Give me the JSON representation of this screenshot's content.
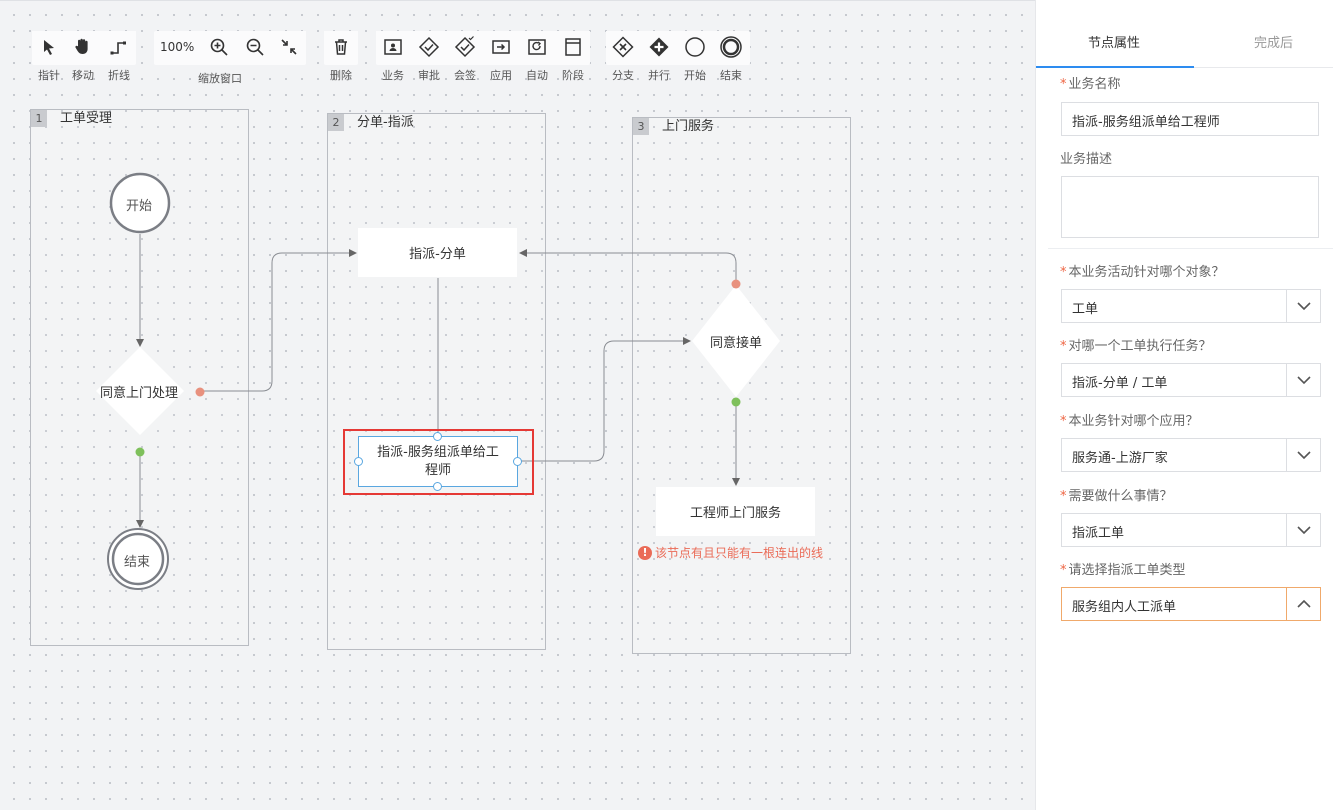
{
  "toolbar": {
    "pointer_label": "指针",
    "move_label": "移动",
    "polyline_label": "折线",
    "zoom_value": "100%",
    "zoom_window_label": "缩放窗口",
    "delete_label": "删除",
    "business_label": "业务",
    "approve_label": "审批",
    "countersign_label": "会签",
    "application_label": "应用",
    "auto_label": "自动",
    "stage_label": "阶段",
    "branch_label": "分支",
    "parallel_label": "并行",
    "start_label": "开始",
    "end_label": "结束"
  },
  "lanes": [
    {
      "num": "1",
      "title": "工单受理"
    },
    {
      "num": "2",
      "title": "分单-指派"
    },
    {
      "num": "3",
      "title": "上门服务"
    }
  ],
  "nodes": {
    "start": "开始",
    "end": "结束",
    "decision_visit": "同意上门处理",
    "assign_split": "指派-分单",
    "assign_engineer": "指派-服务组派单给工程师",
    "decision_accept": "同意接单",
    "engineer_visit": "工程师上门服务",
    "error_message": "该节点有且只能有一根连出的线"
  },
  "panel": {
    "tabs": [
      "节点属性",
      "完成后"
    ],
    "business_name_label": "业务名称",
    "business_name_value": "指派-服务组派单给工程师",
    "business_desc_label": "业务描述",
    "business_desc_value": "",
    "q_object_label": "本业务活动针对哪个对象？",
    "q_object_value": "工单",
    "q_ticket_label": "对哪一个工单执行任务？",
    "q_ticket_value": "指派-分单 / 工单",
    "q_app_label": "本业务针对哪个应用？",
    "q_app_value": "服务通-上游厂家",
    "q_todo_label": "需要做什么事情？",
    "q_todo_value": "指派工单",
    "q_type_label": "请选择指派工单类型",
    "q_type_value": "服务组内人工派单"
  },
  "colors": {
    "accent": "#2d8cf0",
    "selected_border": "#e53935",
    "error": "#ea6b57",
    "start_anchor": "#e8917e",
    "end_anchor": "#7ec05b"
  }
}
